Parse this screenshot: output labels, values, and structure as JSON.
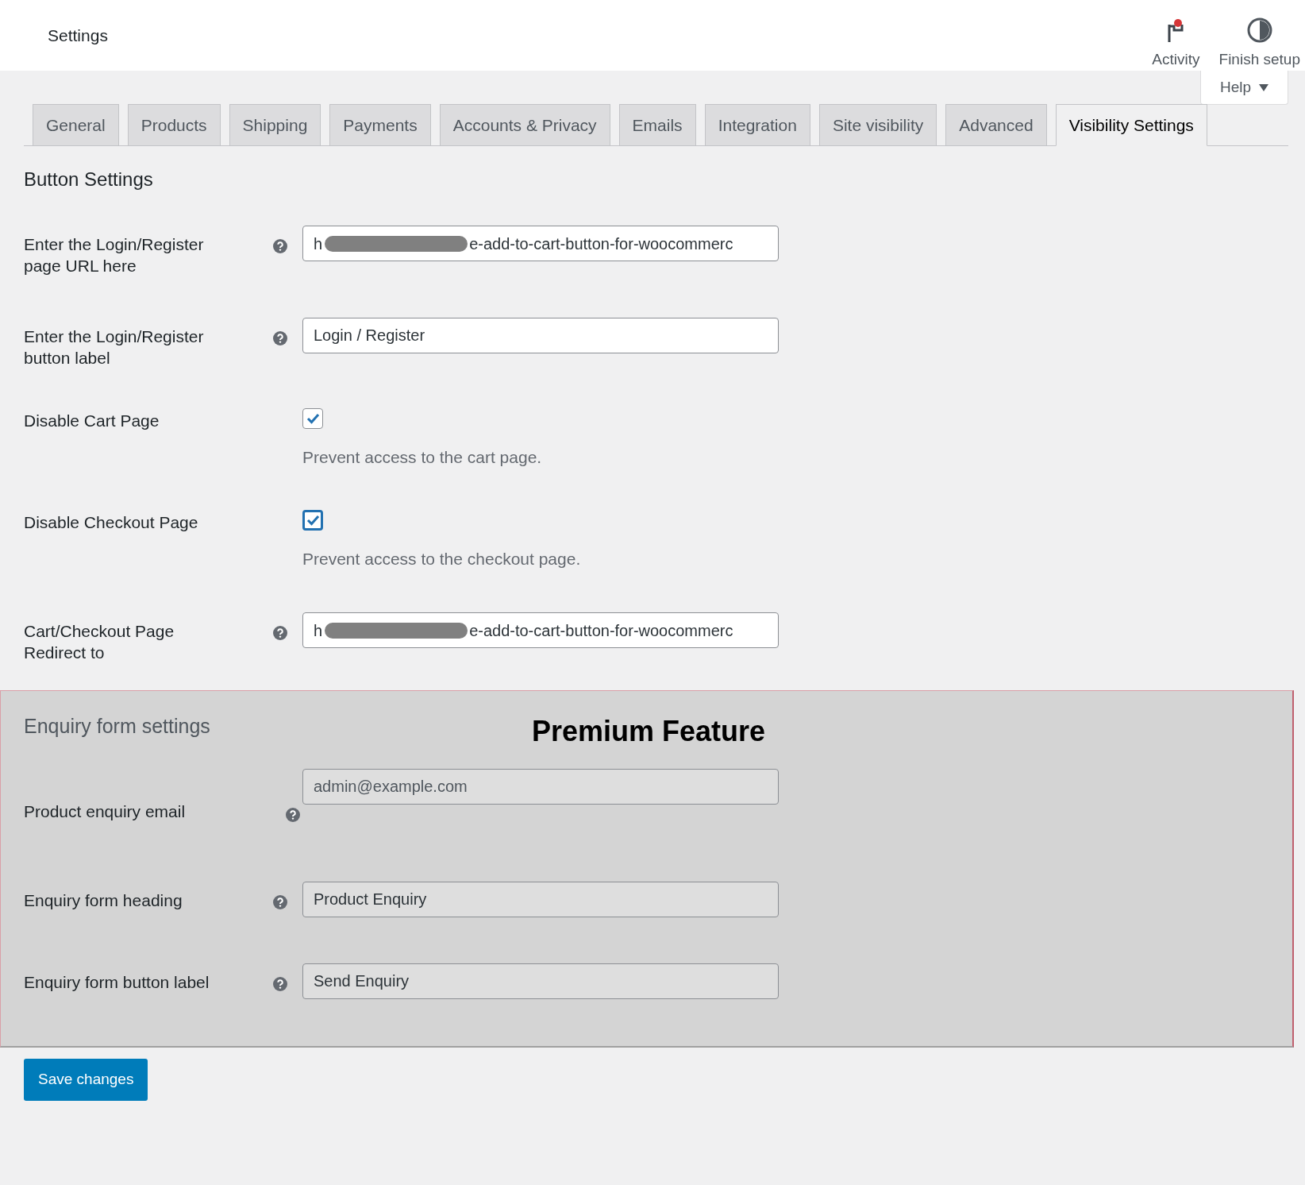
{
  "header": {
    "title": "Settings",
    "actions": [
      {
        "kind": "activity",
        "label": "Activity",
        "unread": true
      },
      {
        "kind": "setup",
        "label": "Finish setup"
      }
    ],
    "help_tab": "Help"
  },
  "tabs": [
    {
      "label": "General",
      "selected": false
    },
    {
      "label": "Products",
      "selected": false
    },
    {
      "label": "Shipping",
      "selected": false
    },
    {
      "label": "Payments",
      "selected": false
    },
    {
      "label": "Accounts & Privacy",
      "selected": false
    },
    {
      "label": "Emails",
      "selected": false
    },
    {
      "label": "Integration",
      "selected": false
    },
    {
      "label": "Site visibility",
      "selected": false
    },
    {
      "label": "Advanced",
      "selected": false
    },
    {
      "label": "Visibility Settings",
      "selected": true
    }
  ],
  "section_heading": "Button Settings",
  "rows": [
    {
      "kind": "redacted",
      "label": "Enter the Login/Register page URL here",
      "help_icon": true,
      "value_start": "h",
      "value_end": "e-add-to-cart-button-for-woocommerc"
    },
    {
      "kind": "text",
      "label": "Enter the Login/Register button label",
      "help_icon": true,
      "value": "Login / Register"
    },
    {
      "kind": "checkbox",
      "label": "Disable Cart Page",
      "help_icon": false,
      "checked": true,
      "focused": false,
      "description": "Prevent access to the cart page."
    },
    {
      "kind": "checkbox",
      "label": "Disable Checkout Page",
      "help_icon": false,
      "checked": true,
      "focused": true,
      "description": "Prevent access to the checkout page."
    },
    {
      "kind": "redacted",
      "label": "Cart/Checkout Page Redirect to",
      "help_icon": true,
      "value_start": "h",
      "value_end": "e-add-to-cart-button-for-woocommerc"
    }
  ],
  "premium": {
    "heading": "Enquiry form settings",
    "badge": "Premium Feature",
    "rows": [
      {
        "kind": "email",
        "label": "Product enquiry email",
        "help_icon": true,
        "placeholder": "admin@example.com"
      },
      {
        "kind": "text",
        "label": "Enquiry form heading",
        "help_icon": true,
        "value": "Product Enquiry"
      },
      {
        "kind": "text",
        "label": "Enquiry form button label",
        "help_icon": true,
        "value": "Send Enquiry"
      }
    ]
  },
  "save_button": "Save changes"
}
